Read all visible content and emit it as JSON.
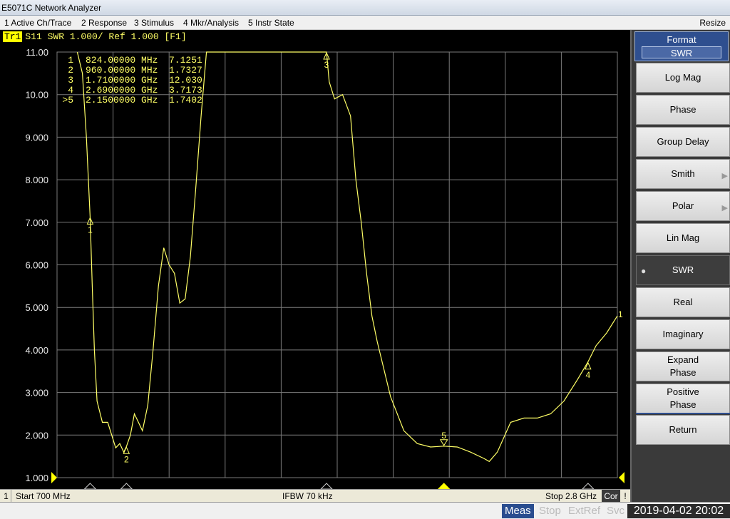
{
  "window": {
    "title": "E5071C Network Analyzer"
  },
  "menu": {
    "items": [
      "1 Active Ch/Trace",
      "2 Response",
      "3 Stimulus",
      "4 Mkr/Analysis",
      "5 Instr State"
    ],
    "resize": "Resize"
  },
  "trace": {
    "badge": "Tr1",
    "label": "S11  SWR 1.000/ Ref 1.000 [F1]"
  },
  "marker_table": [
    {
      "id": "1",
      "freq": "824.00000 MHz",
      "value": "7.1251"
    },
    {
      "id": "2",
      "freq": "960.00000 MHz",
      "value": "1.7327"
    },
    {
      "id": "3",
      "freq": "1.7100000 GHz",
      "value": "12.030"
    },
    {
      "id": "4",
      "freq": "2.6900000 GHz",
      "value": "3.7173"
    },
    {
      "id": ">5",
      "freq": "2.1500000 GHz",
      "value": "1.7402"
    }
  ],
  "status": {
    "channel": "1",
    "start": "Start 700 MHz",
    "ifbw": "IFBW 70 kHz",
    "stop": "Stop 2.8 GHz",
    "cor": "Cor",
    "warn": "!"
  },
  "bottom": {
    "meas": "Meas",
    "stop": "Stop",
    "extref": "ExtRef",
    "svc": "Svc",
    "datetime": "2019-04-02 20:02"
  },
  "softkeys": {
    "header_title": "Format",
    "header_value": "SWR",
    "items": [
      {
        "label": "Log Mag",
        "submenu": false,
        "active": false
      },
      {
        "label": "Phase",
        "submenu": false,
        "active": false
      },
      {
        "label": "Group Delay",
        "submenu": false,
        "active": false
      },
      {
        "label": "Smith",
        "submenu": true,
        "active": false
      },
      {
        "label": "Polar",
        "submenu": true,
        "active": false
      },
      {
        "label": "Lin Mag",
        "submenu": false,
        "active": false
      },
      {
        "label": "SWR",
        "submenu": false,
        "active": true
      },
      {
        "label": "Real",
        "submenu": false,
        "active": false
      },
      {
        "label": "Imaginary",
        "submenu": false,
        "active": false
      },
      {
        "label": "Expand Phase",
        "submenu": false,
        "active": false
      },
      {
        "label": "Positive Phase",
        "submenu": false,
        "active": false
      }
    ],
    "return_label": "Return"
  },
  "chart_data": {
    "type": "line",
    "title": "S11  SWR 1.000/ Ref 1.000 [F1]",
    "xlim": [
      700,
      2800
    ],
    "x_unit": "MHz",
    "ylim": [
      1,
      11
    ],
    "yticks": [
      "11.00",
      "10.00",
      "9.000",
      "8.000",
      "7.000",
      "6.000",
      "5.000",
      "4.000",
      "3.000",
      "2.000",
      "1.000"
    ],
    "grid": true,
    "colors": {
      "trace": "#ffff66",
      "grid": "#7a7a7a",
      "text": "#ffff66"
    },
    "series": [
      {
        "name": "S11",
        "x": [
          776,
          795,
          810,
          824,
          832,
          840,
          850,
          870,
          890,
          905,
          920,
          935,
          950,
          960,
          975,
          990,
          1005,
          1020,
          1040,
          1060,
          1080,
          1100,
          1120,
          1140,
          1160,
          1180,
          1200,
          1220,
          1240,
          1260,
          1280,
          1300,
          1320,
          1340,
          1350,
          1360,
          1700,
          1710,
          1720,
          1740,
          1770,
          1800,
          1820,
          1840,
          1860,
          1880,
          1900,
          1950,
          2000,
          2050,
          2100,
          2150,
          2200,
          2250,
          2300,
          2320,
          2350,
          2400,
          2450,
          2500,
          2550,
          2600,
          2650,
          2690,
          2720,
          2760,
          2800
        ],
        "y": [
          11.0,
          10.5,
          9.0,
          7.13,
          5.5,
          4.0,
          2.8,
          2.3,
          2.3,
          2.0,
          1.7,
          1.8,
          1.6,
          1.73,
          2.0,
          2.5,
          2.3,
          2.1,
          2.7,
          4.0,
          5.5,
          6.4,
          6.0,
          5.8,
          5.1,
          5.2,
          6.2,
          7.8,
          9.5,
          11.0,
          11.0,
          11.0,
          11.0,
          11.0,
          11.0,
          11.0,
          11.0,
          11.0,
          10.3,
          9.9,
          10.0,
          9.5,
          8.0,
          7.0,
          5.8,
          4.8,
          4.2,
          2.9,
          2.1,
          1.8,
          1.72,
          1.74,
          1.72,
          1.6,
          1.45,
          1.38,
          1.6,
          2.3,
          2.4,
          2.4,
          2.5,
          2.8,
          3.3,
          3.72,
          4.1,
          4.4,
          4.8
        ]
      }
    ],
    "markers": [
      {
        "id": "1",
        "x": 824,
        "y": 7.1251
      },
      {
        "id": "2",
        "x": 960,
        "y": 1.7327
      },
      {
        "id": "3",
        "x": 1710,
        "y": 12.03
      },
      {
        "id": "4",
        "x": 2690,
        "y": 3.7173
      },
      {
        "id": "5",
        "x": 2150,
        "y": 1.7402
      }
    ],
    "trace_end_label": "1"
  }
}
